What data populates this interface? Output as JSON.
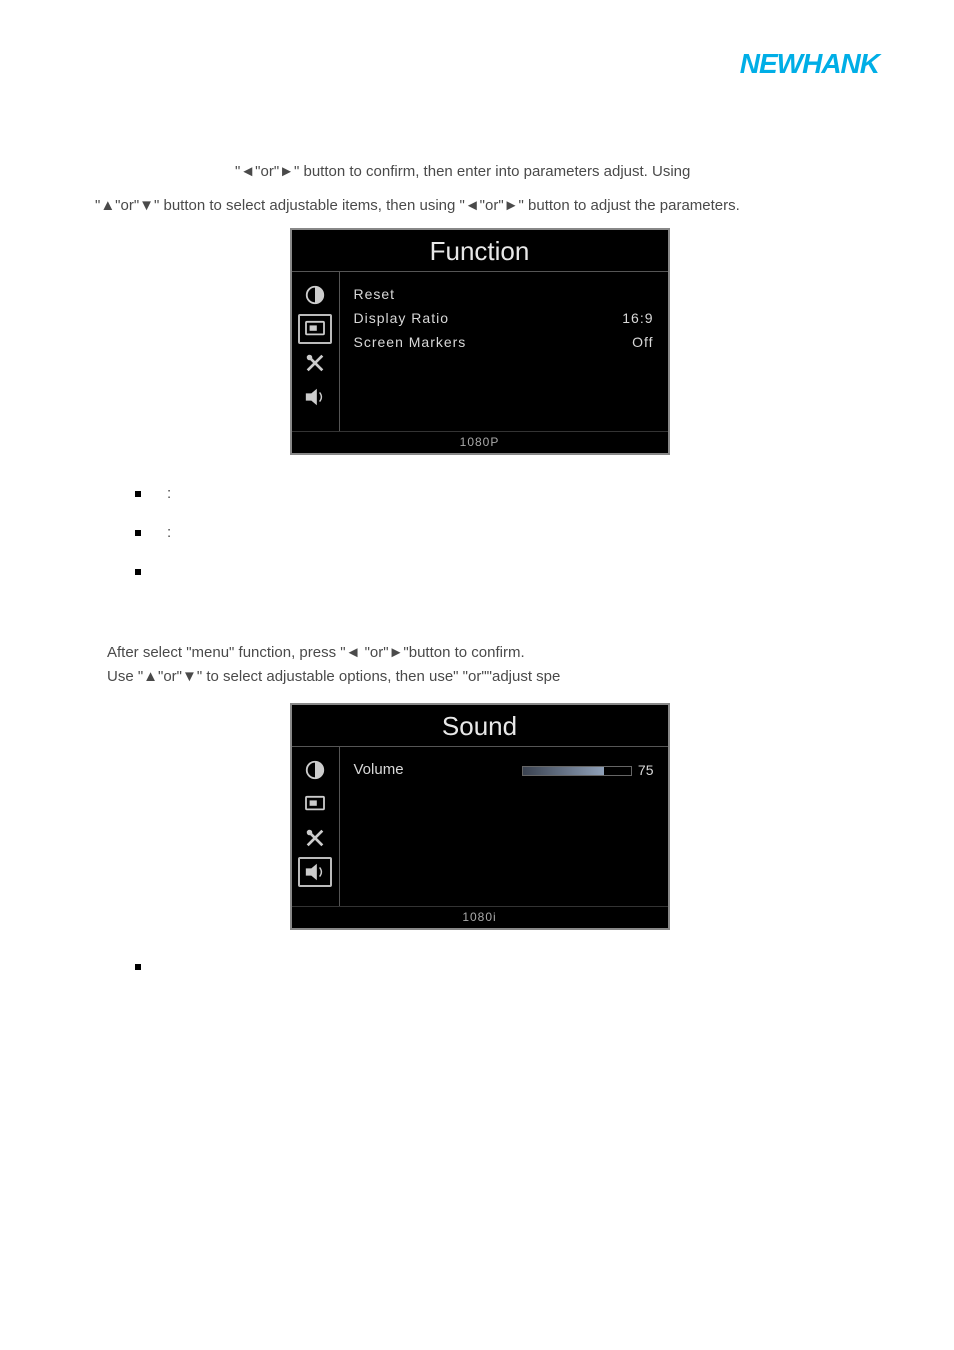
{
  "logo": {
    "main": "NEWHANK",
    "sub": ""
  },
  "section1": {
    "line1_indent": "\"◄\"or\"►\" button to confirm, then enter into parameters adjust. Using",
    "line2": "\"▲\"or\"▼\" button to select adjustable items, then using \"◄\"or\"►\" button to adjust the parameters."
  },
  "osd1": {
    "title": "Function",
    "rows": [
      {
        "label": "Reset",
        "value": ""
      },
      {
        "label": "Display Ratio",
        "value": "16:9"
      },
      {
        "label": "Screen Markers",
        "value": "Off"
      }
    ],
    "footer": "1080P"
  },
  "bullets1": [
    ":",
    ":",
    ""
  ],
  "section2": {
    "line1": "After select \"menu\" function, press \"◄ \"or\"►\"button to confirm.",
    "line2": "Use \"▲\"or\"▼\" to select adjustable options, then use\" \"or\"\"adjust spe"
  },
  "osd2": {
    "title": "Sound",
    "volume_label": "Volume",
    "volume_value": "75",
    "volume_fill_pct": 75,
    "footer": "1080i"
  },
  "bullets2": [
    ""
  ]
}
